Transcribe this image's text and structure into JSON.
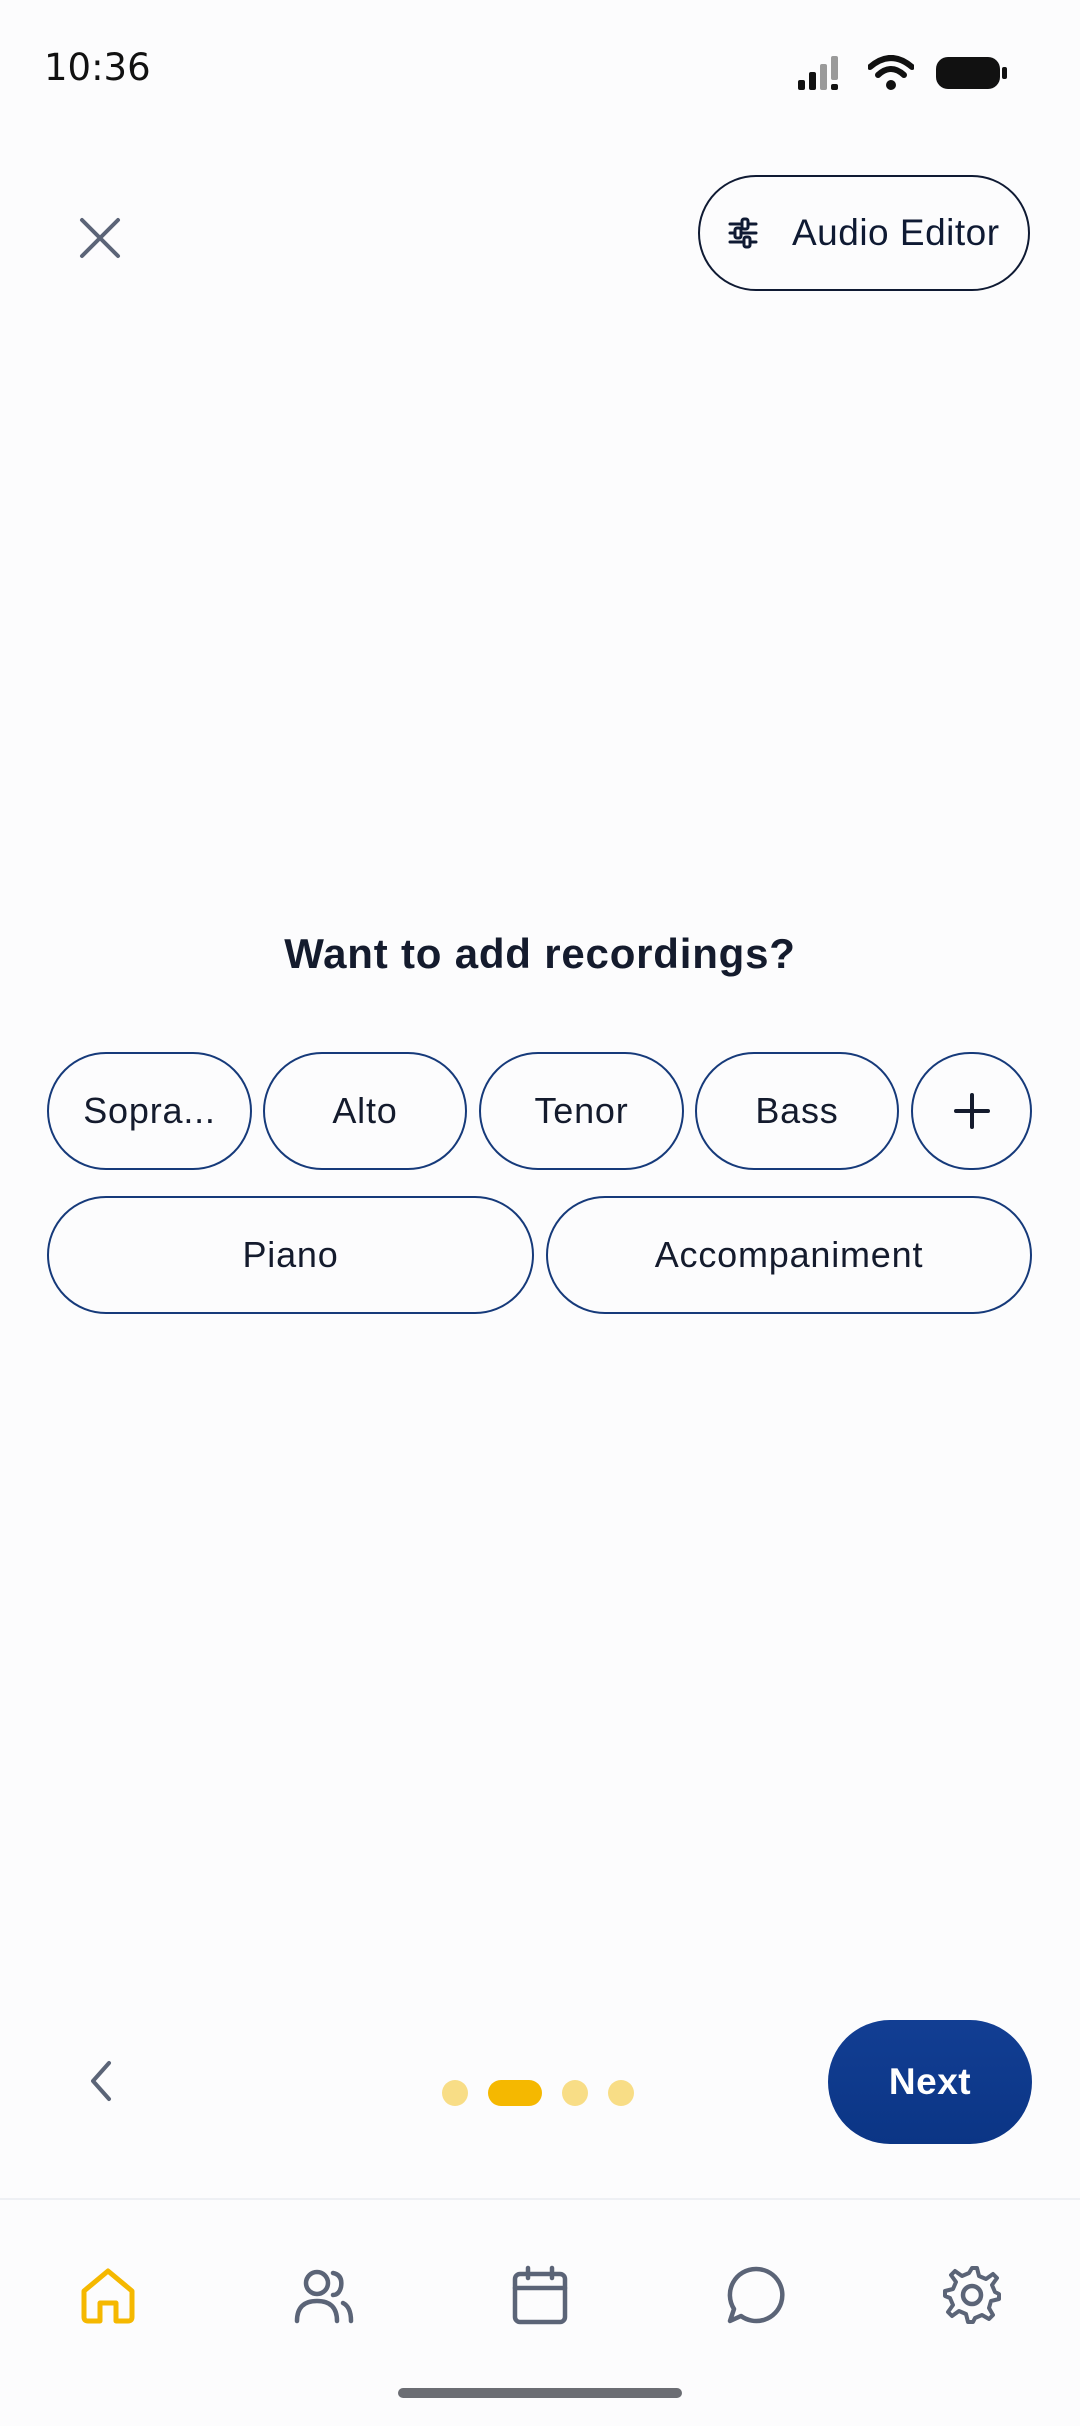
{
  "status_bar": {
    "time": "10:36"
  },
  "header": {
    "close_icon": "close-icon",
    "audio_editor_label": "Audio Editor",
    "audio_editor_icon": "sliders-icon"
  },
  "prompt": {
    "question": "Want to add recordings?"
  },
  "chips": {
    "row1": [
      "Sopra...",
      "Alto",
      "Tenor",
      "Bass"
    ],
    "add_icon": "plus-icon",
    "row2": [
      "Piano",
      "Accompaniment"
    ]
  },
  "navigation": {
    "back_icon": "chevron-left-icon",
    "pager": {
      "total": 4,
      "current": 2
    },
    "next_label": "Next"
  },
  "tab_bar": {
    "items": [
      {
        "name": "home",
        "icon": "home-icon",
        "active": true
      },
      {
        "name": "people",
        "icon": "people-icon",
        "active": false
      },
      {
        "name": "calendar",
        "icon": "calendar-icon",
        "active": false
      },
      {
        "name": "chat",
        "icon": "chat-icon",
        "active": false
      },
      {
        "name": "settings",
        "icon": "gear-icon",
        "active": false
      }
    ]
  },
  "colors": {
    "accent_yellow": "#f5b800",
    "primary_blue": "#0b3585",
    "chip_border": "#163a7a",
    "icon_gray": "#5b6477"
  }
}
